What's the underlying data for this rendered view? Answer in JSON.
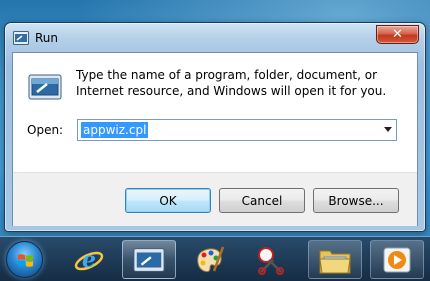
{
  "window": {
    "title": "Run",
    "close_label": "✕",
    "message": "Type the name of a program, folder, document, or Internet resource, and Windows will open it for you.",
    "open_label": "Open:",
    "open_value": "appwiz.cpl"
  },
  "buttons": {
    "ok": "OK",
    "cancel": "Cancel",
    "browse": "Browse..."
  },
  "icons": {
    "run": "run-icon",
    "close": "close-icon",
    "dropdown": "chevron-down-icon"
  },
  "taskbar": {
    "items": [
      {
        "icon": "start-button-icon"
      },
      {
        "icon": "internet-explorer-icon"
      },
      {
        "icon": "run-dialog-icon",
        "state": "active"
      },
      {
        "icon": "paint-icon"
      },
      {
        "icon": "snipping-tool-icon"
      },
      {
        "icon": "windows-explorer-icon",
        "state": "pinned"
      },
      {
        "icon": "media-player-icon",
        "state": "pinned"
      }
    ]
  },
  "colors": {
    "selection": "#3399ff",
    "close_button": "#c0391f",
    "taskbar": "#1c3a58"
  }
}
